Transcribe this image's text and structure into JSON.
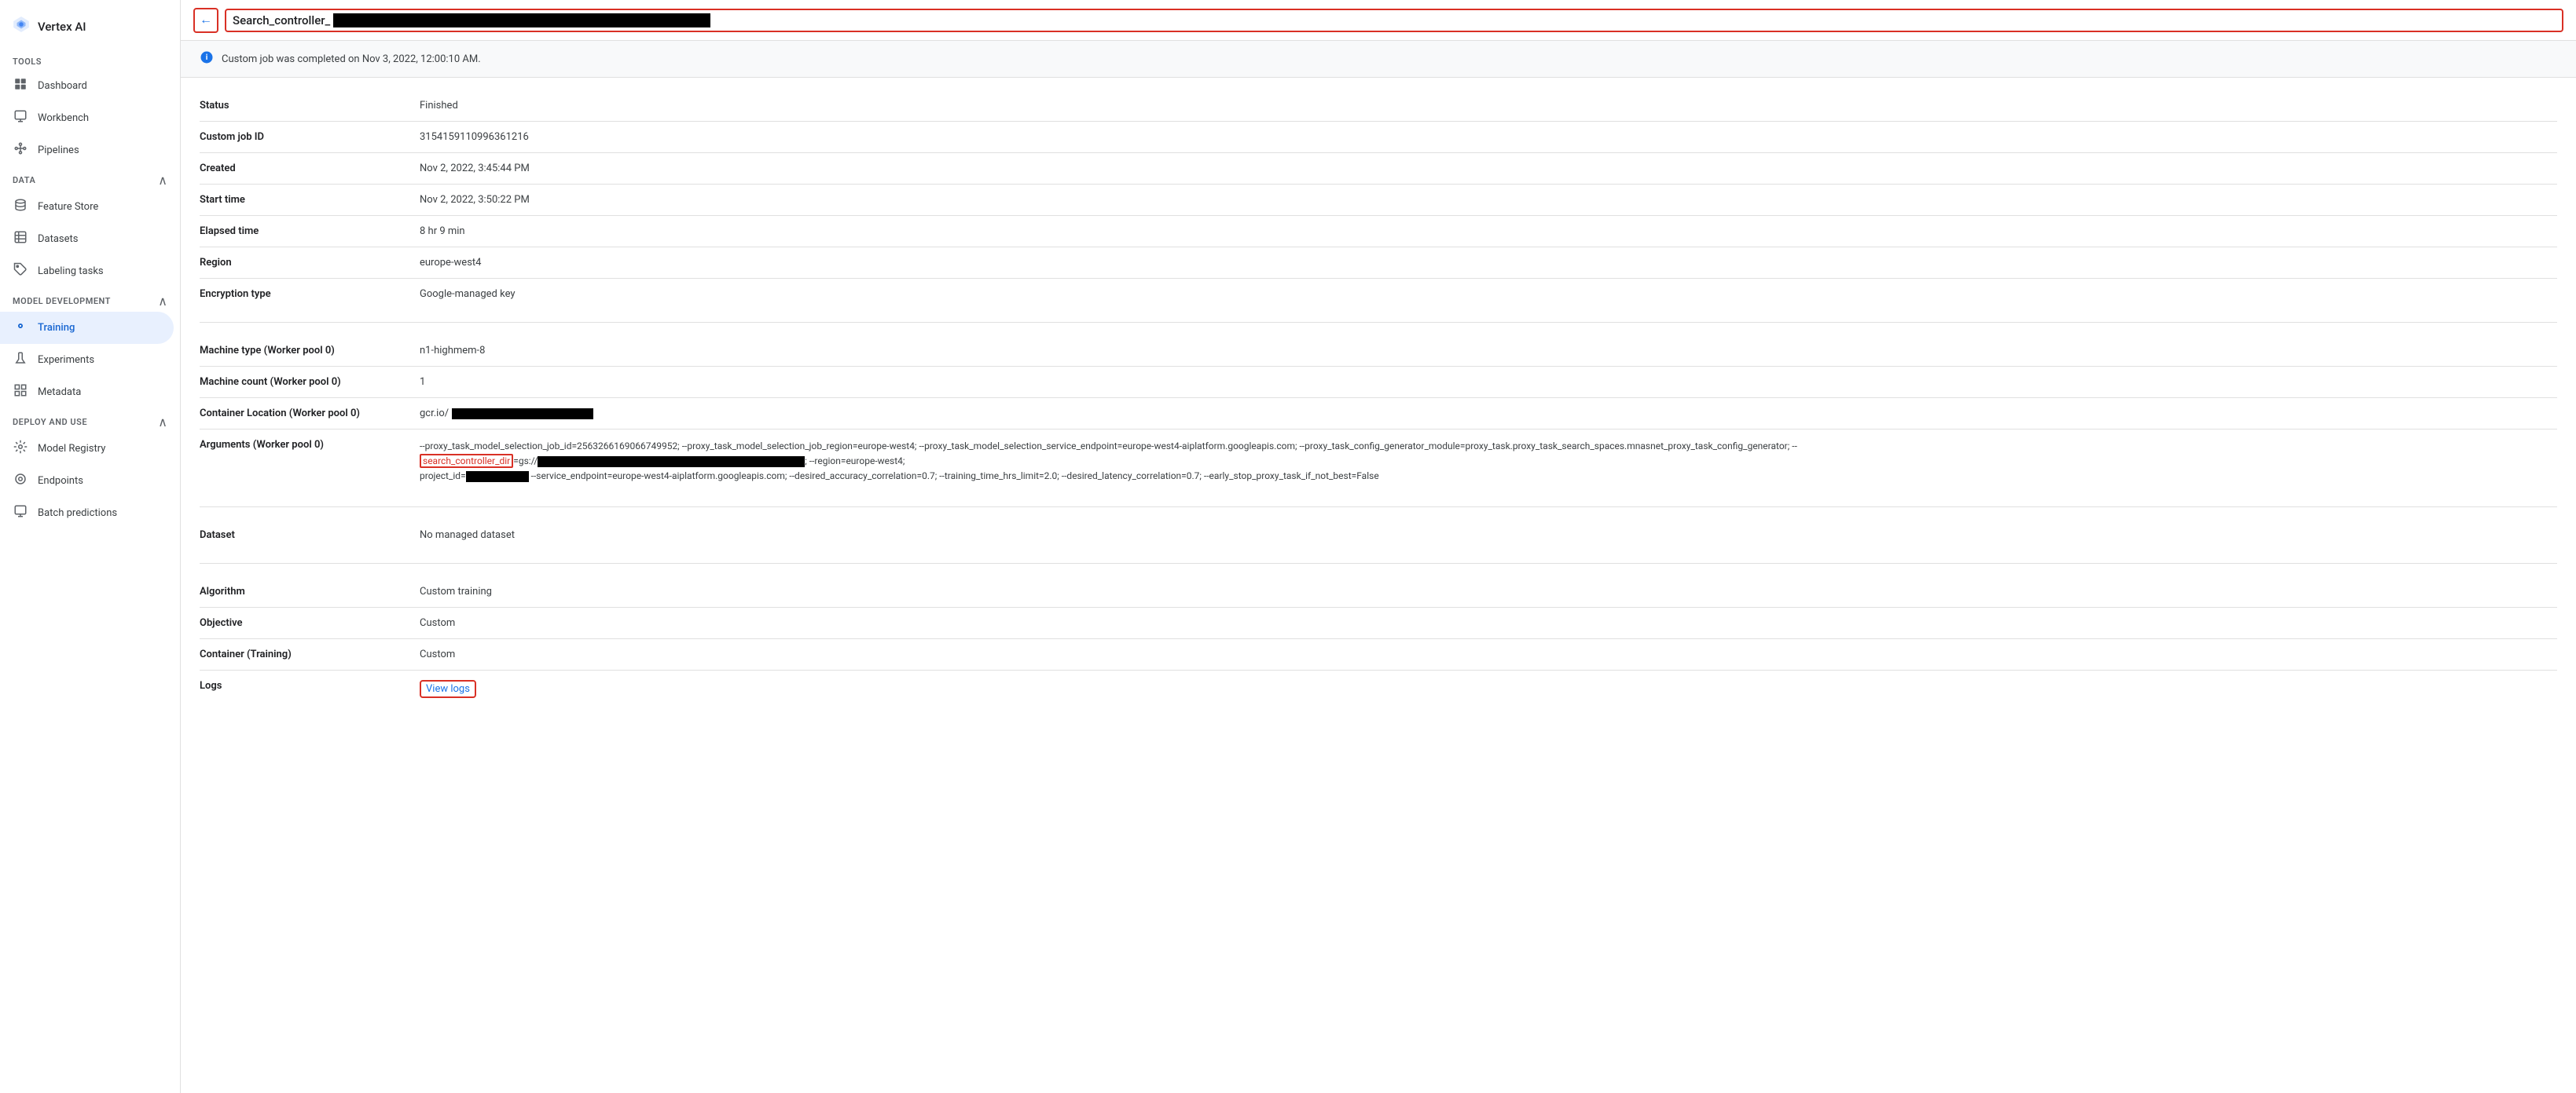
{
  "app": {
    "logo_icon": "⬡",
    "logo_text": "Vertex AI"
  },
  "sidebar": {
    "tools_label": "TOOLS",
    "data_label": "DATA",
    "model_dev_label": "MODEL DEVELOPMENT",
    "deploy_label": "DEPLOY AND USE",
    "items": [
      {
        "id": "dashboard",
        "label": "Dashboard",
        "icon": "⊞"
      },
      {
        "id": "workbench",
        "label": "Workbench",
        "icon": "⊡"
      },
      {
        "id": "pipelines",
        "label": "Pipelines",
        "icon": "≋"
      },
      {
        "id": "feature-store",
        "label": "Feature Store",
        "icon": "◎"
      },
      {
        "id": "datasets",
        "label": "Datasets",
        "icon": "⊟"
      },
      {
        "id": "labeling-tasks",
        "label": "Labeling tasks",
        "icon": "◈"
      },
      {
        "id": "training",
        "label": "Training",
        "icon": "◉",
        "active": true
      },
      {
        "id": "experiments",
        "label": "Experiments",
        "icon": "⋈"
      },
      {
        "id": "metadata",
        "label": "Metadata",
        "icon": "⊞"
      },
      {
        "id": "model-registry",
        "label": "Model Registry",
        "icon": "◎"
      },
      {
        "id": "endpoints",
        "label": "Endpoints",
        "icon": "◉"
      },
      {
        "id": "batch-predictions",
        "label": "Batch predictions",
        "icon": "⊡"
      }
    ]
  },
  "topbar": {
    "back_label": "←",
    "title_prefix": "Search_controller_"
  },
  "banner": {
    "message": "Custom job was completed on Nov 3, 2022, 12:00:10 AM."
  },
  "details": {
    "fields": [
      {
        "label": "Status",
        "value": "Finished"
      },
      {
        "label": "Custom job ID",
        "value": "315415911099636121​6"
      },
      {
        "label": "Created",
        "value": "Nov 2, 2022, 3:45:44 PM"
      },
      {
        "label": "Start time",
        "value": "Nov 2, 2022, 3:50:22 PM"
      },
      {
        "label": "Elapsed time",
        "value": "8 hr 9 min"
      },
      {
        "label": "Region",
        "value": "europe-west4"
      },
      {
        "label": "Encryption type",
        "value": "Google-managed key"
      }
    ],
    "worker_fields": [
      {
        "label": "Machine type (Worker pool 0)",
        "value": "n1-highmem-8"
      },
      {
        "label": "Machine count (Worker pool 0)",
        "value": "1"
      },
      {
        "label": "Container Location (Worker pool 0)",
        "value": "gcr.io/",
        "has_redacted": true
      },
      {
        "label": "Arguments (Worker pool 0)",
        "is_args": true
      }
    ],
    "dataset_fields": [
      {
        "label": "Dataset",
        "value": "No managed dataset"
      }
    ],
    "algorithm_fields": [
      {
        "label": "Algorithm",
        "value": "Custom training"
      },
      {
        "label": "Objective",
        "value": "Custom"
      },
      {
        "label": "Container (Training)",
        "value": "Custom"
      },
      {
        "label": "Logs",
        "is_logs": true
      }
    ]
  },
  "args": {
    "part1": "--proxy_task_model_selection_job_id=256326616906674​9952; --proxy_task_model_selection_job_region=europe-west4; --proxy_task_model_selection_service_endpoint=europe-west4-aiplatform.googleapis.com; --proxy_task_config_generator_module=proxy_task.proxy_task_search_spaces.mnasnet_proxy_task_config_generator; --",
    "highlight": "search_controller_dir",
    "part2": "=gs://",
    "part3": "; --region=europe-west4;",
    "part4": "project_id=",
    "part5": " --service_endpoint=europe-west4-aiplatform.googleapis.com; --desired_accuracy_correlation=0.7; --training_time_hrs_limit=2.0; --desired_latency_correlation=0.7; --early_stop_proxy_task_if_not_best=False"
  },
  "logs": {
    "link_label": "View logs"
  }
}
